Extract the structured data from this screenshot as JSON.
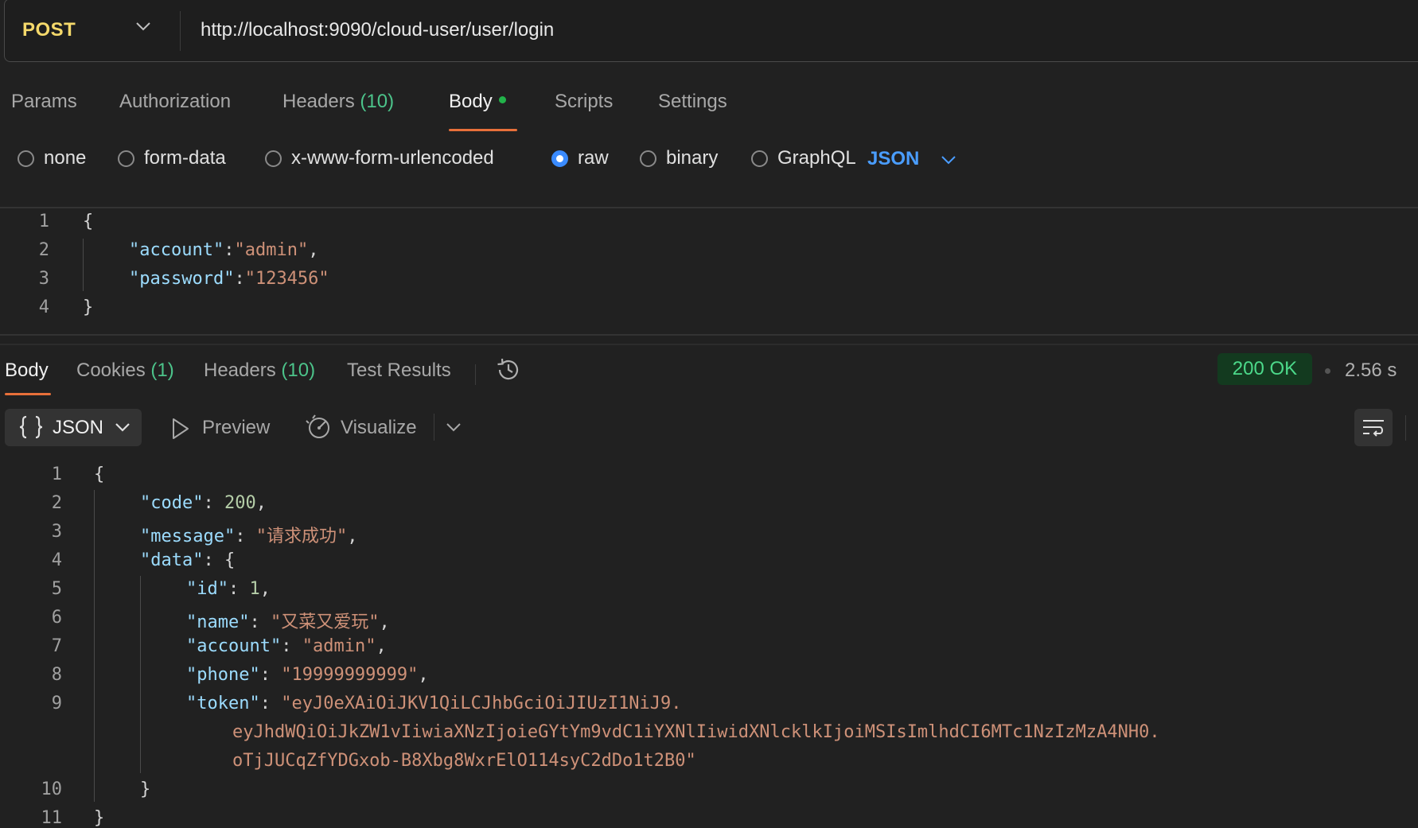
{
  "request": {
    "method": "POST",
    "url": "http://localhost:9090/cloud-user/user/login"
  },
  "request_tabs": [
    {
      "label": "Params"
    },
    {
      "label": "Authorization"
    },
    {
      "label": "Headers",
      "count": "(10)"
    },
    {
      "label": "Body"
    },
    {
      "label": "Scripts"
    },
    {
      "label": "Settings"
    }
  ],
  "body_types": [
    "none",
    "form-data",
    "x-www-form-urlencoded",
    "raw",
    "binary",
    "GraphQL"
  ],
  "selected_body_type": "raw",
  "raw_format": "JSON",
  "request_body": {
    "line_numbers": [
      "1",
      "2",
      "3",
      "4"
    ],
    "open": "{",
    "close": "}",
    "key1": "\"account\"",
    "val1": "\"admin\"",
    "key2": "\"password\"",
    "val2": "\"123456\""
  },
  "response_tabs": [
    {
      "label": "Body"
    },
    {
      "label": "Cookies",
      "count": "(1)"
    },
    {
      "label": "Headers",
      "count": "(10)"
    },
    {
      "label": "Test Results"
    }
  ],
  "status": "200 OK",
  "time": "2.56 s",
  "response_toolbar": {
    "format": "JSON",
    "preview": "Preview",
    "visualize": "Visualize"
  },
  "response_body": {
    "line_numbers": [
      "1",
      "2",
      "3",
      "4",
      "5",
      "6",
      "7",
      "8",
      "9",
      "10",
      "11"
    ],
    "code_key": "\"code\"",
    "code_val": "200",
    "message_key": "\"message\"",
    "message_val": "\"请求成功\"",
    "data_key": "\"data\"",
    "id_key": "\"id\"",
    "id_val": "1",
    "name_key": "\"name\"",
    "name_val": "\"又菜又爱玩\"",
    "account_key": "\"account\"",
    "account_val": "\"admin\"",
    "phone_key": "\"phone\"",
    "phone_val": "\"19999999999\"",
    "token_key": "\"token\"",
    "token_line1": "\"eyJ0eXAiOiJKV1QiLCJhbGciOiJIUzI1NiJ9.",
    "token_line2": "eyJhdWQiOiJkZW1vIiwiaXNzIjoieGYtYm9vdC1iYXNlIiwidXNlcklkIjoiMSIsImlhdCI6MTc1NzIzMzA4NH0.",
    "token_line3": "oTjJUCqZfYDGxob-B8Xbg8WxrElO114syC2dDo1t2B0\""
  },
  "colors": {
    "background": "#212121",
    "method": "#f5d96b",
    "accent_orange": "#e8703a",
    "json_key": "#9cdcfe",
    "json_string": "#ce9178",
    "json_number": "#b5cea8",
    "status_green": "#4cd98a",
    "link_blue": "#4a9dff"
  },
  "icons": [
    "chevron-down-icon",
    "history-icon",
    "braces-icon",
    "play-icon",
    "visualize-icon",
    "wrap-lines-icon"
  ]
}
